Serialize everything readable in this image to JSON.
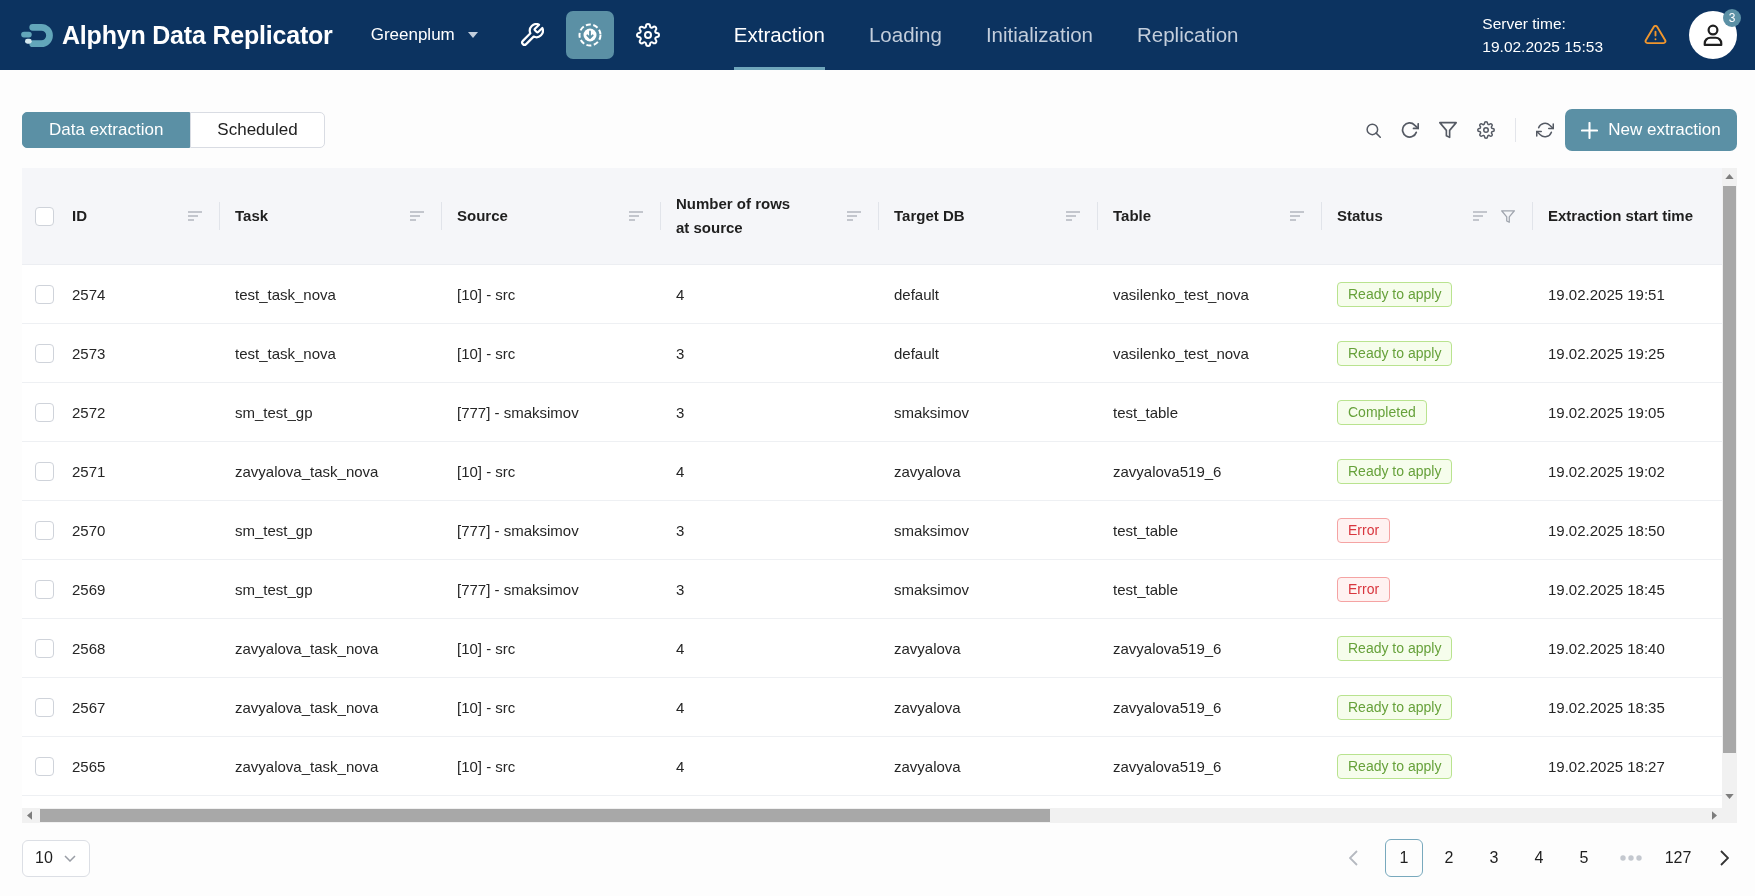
{
  "header": {
    "app_title": "Alphyn Data Replicator",
    "database_select": {
      "value": "Greenplum"
    },
    "tool_buttons": [
      {
        "kind": "wrench",
        "selected": false
      },
      {
        "kind": "download",
        "selected": true
      },
      {
        "kind": "gear",
        "selected": false
      }
    ],
    "nav_tabs": [
      {
        "label": "Extraction",
        "selected": true
      },
      {
        "label": "Loading",
        "selected": false
      },
      {
        "label": "Initialization",
        "selected": false
      },
      {
        "label": "Replication",
        "selected": false
      }
    ],
    "server_time": {
      "label": "Server time:",
      "value": "19.02.2025 15:53"
    },
    "notification_count": "3"
  },
  "view_tabs": [
    {
      "label": "Data extraction",
      "selected": true
    },
    {
      "label": "Scheduled",
      "selected": false
    }
  ],
  "toolbar": {
    "new_button": "New extraction"
  },
  "table": {
    "select_all": {
      "checked": false
    },
    "columns": [
      {
        "label": "ID",
        "sortable": true,
        "filterable": false
      },
      {
        "label": "Task",
        "sortable": true,
        "filterable": false
      },
      {
        "label": "Source",
        "sortable": true,
        "filterable": false
      },
      {
        "label": "Number of rows at source",
        "sortable": true,
        "filterable": false
      },
      {
        "label": "Target DB",
        "sortable": true,
        "filterable": false
      },
      {
        "label": "Table",
        "sortable": true,
        "filterable": false
      },
      {
        "label": "Status",
        "sortable": true,
        "filterable": true
      },
      {
        "label": "Extraction start time",
        "sortable": false,
        "filterable": false
      }
    ],
    "rows": [
      {
        "checked": false,
        "id": "2574",
        "task": "test_task_nova",
        "source": "[10] - src",
        "rows_at_source": "4",
        "target_db": "default",
        "table": "vasilenko_test_nova",
        "status": {
          "label": "Ready to apply",
          "kind": "success"
        },
        "start_time": "19.02.2025 19:51"
      },
      {
        "checked": false,
        "id": "2573",
        "task": "test_task_nova",
        "source": "[10] - src",
        "rows_at_source": "3",
        "target_db": "default",
        "table": "vasilenko_test_nova",
        "status": {
          "label": "Ready to apply",
          "kind": "success"
        },
        "start_time": "19.02.2025 19:25"
      },
      {
        "checked": false,
        "id": "2572",
        "task": "sm_test_gp",
        "source": "[777] - smaksimov",
        "rows_at_source": "3",
        "target_db": "smaksimov",
        "table": "test_table",
        "status": {
          "label": "Completed",
          "kind": "success"
        },
        "start_time": "19.02.2025 19:05"
      },
      {
        "checked": false,
        "id": "2571",
        "task": "zavyalova_task_nova",
        "source": "[10] - src",
        "rows_at_source": "4",
        "target_db": "zavyalova",
        "table": "zavyalova519_6",
        "status": {
          "label": "Ready to apply",
          "kind": "success"
        },
        "start_time": "19.02.2025 19:02"
      },
      {
        "checked": false,
        "id": "2570",
        "task": "sm_test_gp",
        "source": "[777] - smaksimov",
        "rows_at_source": "3",
        "target_db": "smaksimov",
        "table": "test_table",
        "status": {
          "label": "Error",
          "kind": "error"
        },
        "start_time": "19.02.2025 18:50"
      },
      {
        "checked": false,
        "id": "2569",
        "task": "sm_test_gp",
        "source": "[777] - smaksimov",
        "rows_at_source": "3",
        "target_db": "smaksimov",
        "table": "test_table",
        "status": {
          "label": "Error",
          "kind": "error"
        },
        "start_time": "19.02.2025 18:45"
      },
      {
        "checked": false,
        "id": "2568",
        "task": "zavyalova_task_nova",
        "source": "[10] - src",
        "rows_at_source": "4",
        "target_db": "zavyalova",
        "table": "zavyalova519_6",
        "status": {
          "label": "Ready to apply",
          "kind": "success"
        },
        "start_time": "19.02.2025 18:40"
      },
      {
        "checked": false,
        "id": "2567",
        "task": "zavyalova_task_nova",
        "source": "[10] - src",
        "rows_at_source": "4",
        "target_db": "zavyalova",
        "table": "zavyalova519_6",
        "status": {
          "label": "Ready to apply",
          "kind": "success"
        },
        "start_time": "19.02.2025 18:35"
      },
      {
        "checked": false,
        "id": "2565",
        "task": "zavyalova_task_nova",
        "source": "[10] - src",
        "rows_at_source": "4",
        "target_db": "zavyalova",
        "table": "zavyalova519_6",
        "status": {
          "label": "Ready to apply",
          "kind": "success"
        },
        "start_time": "19.02.2025 18:27"
      }
    ]
  },
  "pagination": {
    "page_size": "10",
    "previous": {
      "disabled": true
    },
    "next": {
      "disabled": false
    },
    "pages": [
      {
        "kind": "page",
        "label": "1",
        "selected": true
      },
      {
        "kind": "page",
        "label": "2",
        "selected": false
      },
      {
        "kind": "page",
        "label": "3",
        "selected": false
      },
      {
        "kind": "page",
        "label": "4",
        "selected": false
      },
      {
        "kind": "page",
        "label": "5",
        "selected": false
      },
      {
        "kind": "ellipsis",
        "selected": false
      },
      {
        "kind": "page",
        "label": "127",
        "selected": false
      }
    ]
  }
}
